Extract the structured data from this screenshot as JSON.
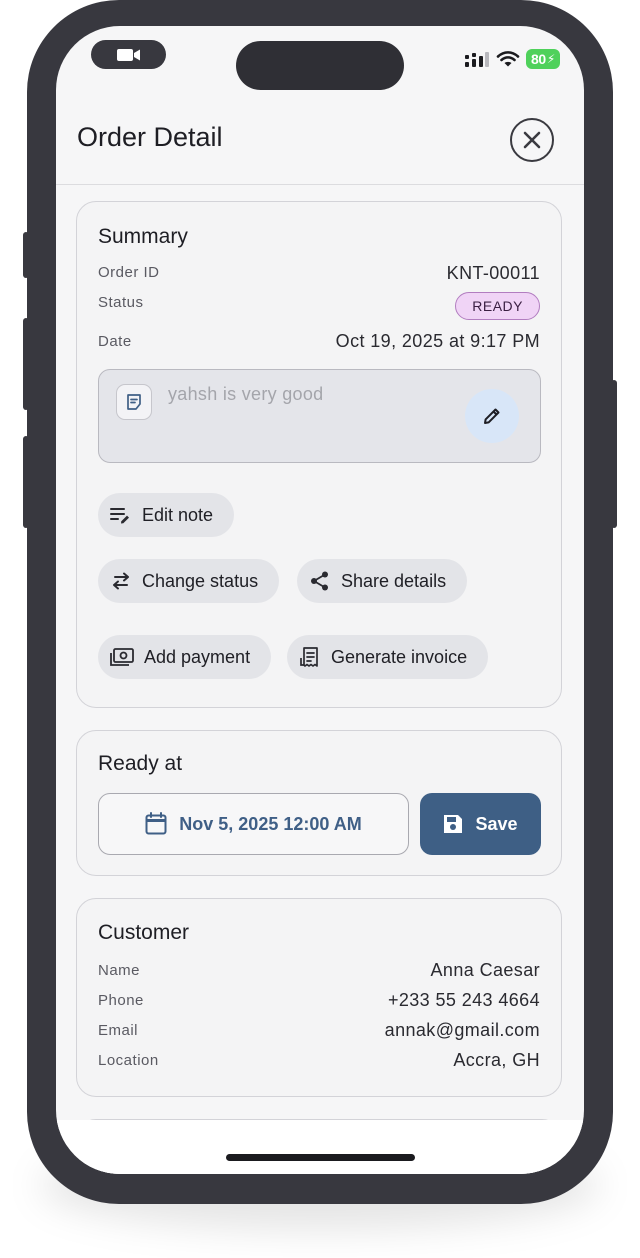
{
  "header": {
    "title": "Order Detail"
  },
  "summary": {
    "title": "Summary",
    "order_id_label": "Order ID",
    "order_id": "KNT-00011",
    "status_label": "Status",
    "status": "READY",
    "date_label": "Date",
    "date": "Oct 19, 2025 at 9:17 PM",
    "note": "yahsh is very good",
    "actions": {
      "edit_note": "Edit note",
      "change_status": "Change status",
      "share_details": "Share details",
      "add_payment": "Add payment",
      "generate_invoice": "Generate invoice"
    }
  },
  "ready_at": {
    "title": "Ready at",
    "date_value": "Nov 5, 2025 12:00 AM",
    "save_label": "Save"
  },
  "customer": {
    "title": "Customer",
    "name_label": "Name",
    "name": "Anna Caesar",
    "phone_label": "Phone",
    "phone": "+233 55 243 4664",
    "email_label": "Email",
    "email": "annak@gmail.com",
    "location_label": "Location",
    "location": "Accra, GH"
  },
  "status_bar": {
    "battery": "80"
  },
  "colors": {
    "accent": "#3e5f85",
    "badge_bg": "#f0d4f6",
    "badge_border": "#b27dc0",
    "note_edit_bg": "#d8e6f8",
    "battery": "#4fd15b"
  },
  "icons": {
    "camera": "video-camera-icon",
    "close": "close-circle-icon",
    "note": "note-icon",
    "pencil": "pencil-icon",
    "edit_note": "edit-note-icon",
    "swap": "swap-icon",
    "share": "share-icon",
    "payment": "payment-icon",
    "invoice": "invoice-icon",
    "calendar": "calendar-icon",
    "save": "save-icon"
  }
}
